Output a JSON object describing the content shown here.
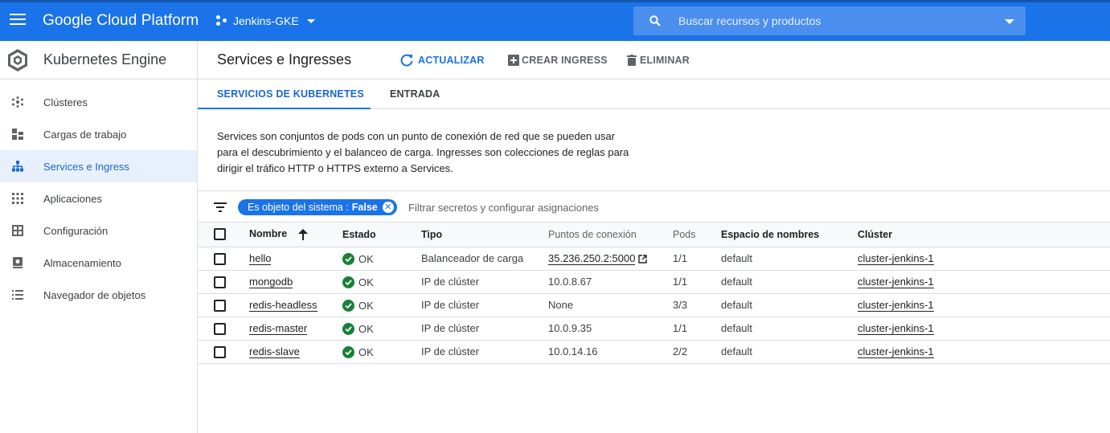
{
  "header": {
    "brand": "Google Cloud Platform",
    "project": "Jenkins-GKE",
    "search_placeholder": "Buscar recursos y productos"
  },
  "sidebar": {
    "title": "Kubernetes Engine",
    "items": [
      {
        "label": "Clústeres",
        "icon": "clusters-icon"
      },
      {
        "label": "Cargas de trabajo",
        "icon": "workloads-icon"
      },
      {
        "label": "Services e Ingress",
        "icon": "services-icon",
        "active": true
      },
      {
        "label": "Aplicaciones",
        "icon": "apps-icon"
      },
      {
        "label": "Configuración",
        "icon": "config-icon"
      },
      {
        "label": "Almacenamiento",
        "icon": "storage-icon"
      },
      {
        "label": "Navegador de objetos",
        "icon": "object-browser-icon"
      }
    ]
  },
  "main": {
    "title": "Services e Ingresses",
    "actions": {
      "refresh": "ACTUALIZAR",
      "create_ingress": "CREAR INGRESS",
      "delete": "ELIMINAR"
    },
    "tabs": [
      "SERVICIOS DE KUBERNETES",
      "ENTRADA"
    ],
    "description_lines": [
      "Services son conjuntos de pods con un punto de conexión de red que se pueden usar",
      "para el descubrimiento y el balanceo de carga. Ingresses son colecciones de reglas para",
      "dirigir el tráfico HTTP o HTTPS externo a Services."
    ],
    "filter": {
      "chip_key": "Es objeto del sistema :",
      "chip_value": "False",
      "placeholder": "Filtrar secretos y configurar asignaciones"
    },
    "table": {
      "headers": {
        "name": "Nombre",
        "status": "Estado",
        "type": "Tipo",
        "endpoints": "Puntos de conexión",
        "pods": "Pods",
        "namespace": "Espacio de nombres",
        "cluster": "Clúster"
      },
      "rows": [
        {
          "name": "hello",
          "status": "OK",
          "type": "Balanceador de carga",
          "endpoints": "35.236.250.2:5000",
          "pods": "1/1",
          "namespace": "default",
          "cluster": "cluster-jenkins-1"
        },
        {
          "name": "mongodb",
          "status": "OK",
          "type": "IP de clúster",
          "endpoints": "10.0.8.67",
          "pods": "1/1",
          "namespace": "default",
          "cluster": "cluster-jenkins-1"
        },
        {
          "name": "redis-headless",
          "status": "OK",
          "type": "IP de clúster",
          "endpoints": "None",
          "pods": "3/3",
          "namespace": "default",
          "cluster": "cluster-jenkins-1"
        },
        {
          "name": "redis-master",
          "status": "OK",
          "type": "IP de clúster",
          "endpoints": "10.0.9.35",
          "pods": "1/1",
          "namespace": "default",
          "cluster": "cluster-jenkins-1"
        },
        {
          "name": "redis-slave",
          "status": "OK",
          "type": "IP de clúster",
          "endpoints": "10.0.14.16",
          "pods": "2/2",
          "namespace": "default",
          "cluster": "cluster-jenkins-1"
        }
      ]
    }
  },
  "colors": {
    "topbar": "#1a73e8",
    "accent": "#1a73e8",
    "ok": "#188038",
    "active_nav_bg": "#e8f0fe"
  }
}
